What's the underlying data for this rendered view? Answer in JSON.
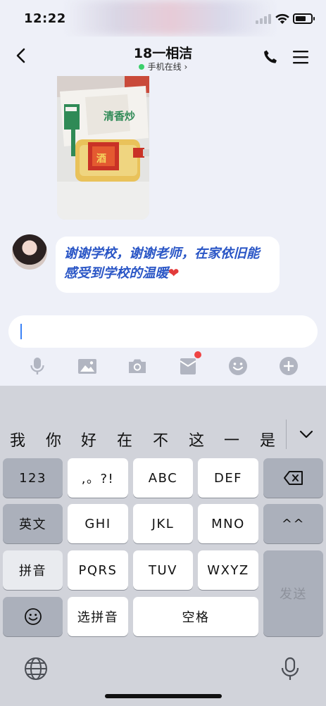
{
  "status_bar": {
    "time": "12:22"
  },
  "header": {
    "title": "18一相洁",
    "status": "手机在线",
    "status_chevron": "›"
  },
  "chat": {
    "message_text": "谢谢学校，谢谢老师，在家依旧能感受到学校的温暖",
    "message_emoji": "❤",
    "photo_label_top": "清香炒",
    "photo_label_bottle": "酒"
  },
  "input": {
    "value": ""
  },
  "toolbar": [
    "mic-icon",
    "image-icon",
    "camera-icon",
    "red-packet-icon",
    "emoji-icon",
    "plus-icon"
  ],
  "keyboard": {
    "candidates": [
      "我",
      "你",
      "好",
      "在",
      "不",
      "这",
      "一",
      "是"
    ],
    "keys": {
      "num": "123",
      "punct": ",。?!",
      "abc": "ABC",
      "def": "DEF",
      "lang": "英文",
      "ghi": "GHI",
      "jkl": "JKL",
      "mno": "MNO",
      "emoticon": "^^",
      "pinyin": "拼音",
      "pqrs": "PQRS",
      "tuv": "TUV",
      "wxyz": "WXYZ",
      "send": "发送",
      "select_pinyin": "选拼音",
      "space": "空格"
    }
  },
  "colors": {
    "accent": "#2a56c6",
    "online": "#3ccf6b",
    "badge": "#ef4444",
    "background": "#eef0f8",
    "keyboard": "#d1d3da"
  }
}
